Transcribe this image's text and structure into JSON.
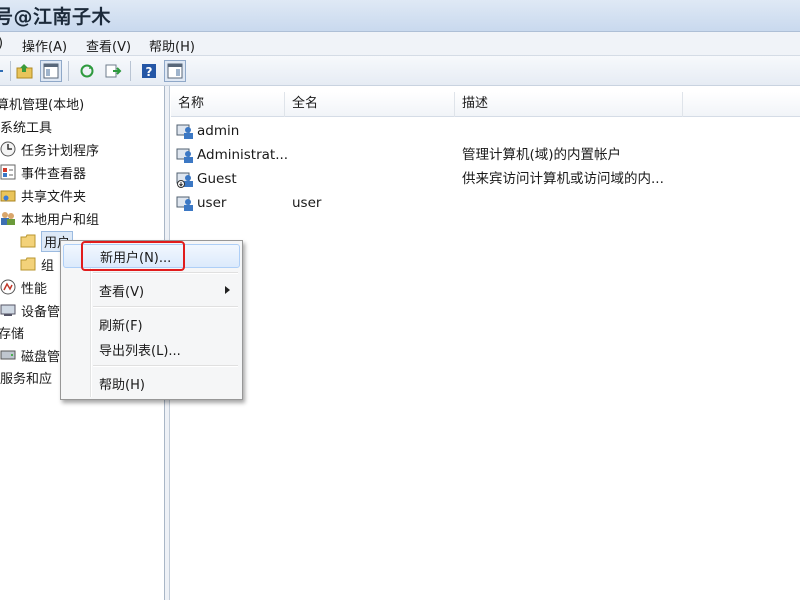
{
  "window": {
    "title": "号@江南子木"
  },
  "menubar": {
    "items": [
      ")",
      "操作(A)",
      "查看(V)",
      "帮助(H)"
    ]
  },
  "toolbar": {
    "buttons": [
      "back-icon",
      "up-folder-icon",
      "show-tree-icon",
      "refresh-icon",
      "export-icon",
      "help-icon",
      "properties-icon"
    ]
  },
  "tree": {
    "items": [
      {
        "label": "算机管理(本地)",
        "icon": "computer-icon"
      },
      {
        "label": "系统工具",
        "icon": "tools-icon"
      },
      {
        "label": "任务计划程序",
        "icon": "clock-icon"
      },
      {
        "label": "事件查看器",
        "icon": "event-viewer-icon"
      },
      {
        "label": "共享文件夹",
        "icon": "shared-folder-icon"
      },
      {
        "label": "本地用户和组",
        "icon": "users-groups-icon"
      },
      {
        "label": "用户",
        "icon": "folder-icon"
      },
      {
        "label": "组",
        "icon": "folder-icon"
      },
      {
        "label": "性能",
        "icon": "performance-icon"
      },
      {
        "label": "设备管",
        "icon": "device-manager-icon"
      },
      {
        "label": "存储",
        "icon": ""
      },
      {
        "label": "磁盘管",
        "icon": "disk-icon"
      },
      {
        "label": "服务和应",
        "icon": ""
      }
    ]
  },
  "listview": {
    "columns": [
      "名称",
      "全名",
      "描述"
    ],
    "rows": [
      {
        "name": "admin",
        "full": "",
        "desc": ""
      },
      {
        "name": "Administrat...",
        "full": "",
        "desc": "管理计算机(域)的内置帐户"
      },
      {
        "name": "Guest",
        "full": "",
        "desc": "供来宾访问计算机或访问域的内..."
      },
      {
        "name": "user",
        "full": "user",
        "desc": ""
      }
    ]
  },
  "context_menu": {
    "new_user": "新用户(N)...",
    "view": "查看(V)",
    "refresh": "刷新(F)",
    "export": "导出列表(L)...",
    "help": "帮助(H)"
  },
  "colors": {
    "annotation": "#e11c1c",
    "selection": "#dde9f7"
  }
}
